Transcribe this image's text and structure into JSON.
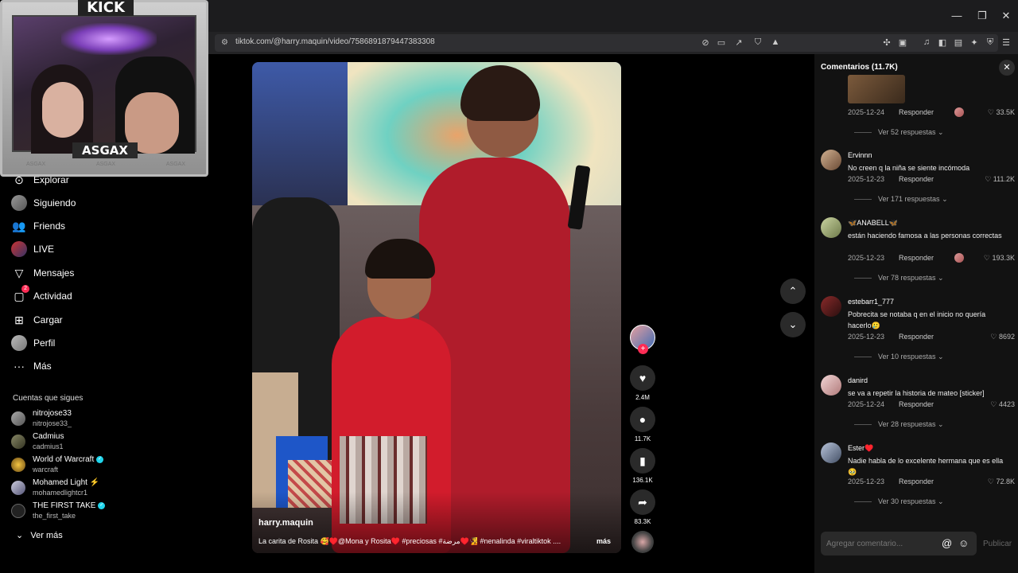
{
  "browser": {
    "url": "tiktok.com/@harry.maquin/video/7586891879447383308",
    "window_controls": [
      "—",
      "❐",
      "✕"
    ]
  },
  "webcam": {
    "brand": "KICK",
    "streamer": "ASGAX",
    "socials": [
      "ASGAX",
      "ASGAX",
      "ASGAX"
    ]
  },
  "sidebar": {
    "nav": [
      {
        "label": "Explorar",
        "icon": "explore-icon"
      },
      {
        "label": "Siguiendo",
        "icon": "following-icon"
      },
      {
        "label": "Friends",
        "icon": "friends-icon"
      },
      {
        "label": "LIVE",
        "icon": "live-icon"
      },
      {
        "label": "Mensajes",
        "icon": "messages-icon"
      },
      {
        "label": "Actividad",
        "icon": "activity-icon",
        "badge": "2"
      },
      {
        "label": "Cargar",
        "icon": "upload-icon"
      },
      {
        "label": "Perfil",
        "icon": "profile-icon"
      },
      {
        "label": "Más",
        "icon": "more-icon"
      }
    ],
    "following_title": "Cuentas que sigues",
    "following": [
      {
        "name": "nitrojose33",
        "user": "nitrojose33_",
        "verified": false
      },
      {
        "name": "Cadmius",
        "user": "cadmius1",
        "verified": false
      },
      {
        "name": "World of Warcraft",
        "user": "warcraft",
        "verified": true
      },
      {
        "name": "Mohamed Light ⚡",
        "user": "mohamedlightcr1",
        "verified": false
      },
      {
        "name": "THE FIRST TAKE",
        "user": "the_first_take",
        "verified": true
      }
    ],
    "see_more": "Ver más"
  },
  "video": {
    "author": "harry.maquin",
    "caption": "La carita de Rosita 🥰♥️@Mona y Rosita♥️ #preciosas #مرضة♥️🧏 #nenalinda #viraltiktok ....",
    "more": "más"
  },
  "actions": {
    "likes": "2.4M",
    "comments": "11.7K",
    "saves": "136.1K",
    "shares": "83.3K"
  },
  "comments_panel": {
    "title": "Comentarios (11.7K)",
    "reply_label": "Responder",
    "input_placeholder": "Agregar comentario...",
    "publish_label": "Publicar",
    "comments": [
      {
        "user": "",
        "text": "",
        "date": "2025-12-24",
        "likes": "33.5K",
        "creator_liked": true,
        "replies": "Ver 52 respuestas"
      },
      {
        "user": "Ervinnn",
        "text": "No creen q la niña se siente incómoda",
        "date": "2025-12-23",
        "likes": "111.2K",
        "creator_liked": false,
        "replies": "Ver 171 respuestas"
      },
      {
        "user": "🦋ANABELL🦋",
        "text": "están haciendo famosa a las personas correctas",
        "date": "2025-12-23",
        "likes": "193.3K",
        "creator_liked": true,
        "replies": "Ver 78 respuestas"
      },
      {
        "user": "estebarr1_777",
        "text": "Pobrecita se notaba q en el inicio no quería hacerlo🥲",
        "date": "2025-12-23",
        "likes": "8692",
        "creator_liked": false,
        "replies": "Ver 10 respuestas"
      },
      {
        "user": "danird",
        "text": "se va a repetir la historia de mateo [sticker]",
        "date": "2025-12-24",
        "likes": "4423",
        "creator_liked": false,
        "replies": "Ver 28 respuestas"
      },
      {
        "user": "Ester♥️",
        "text": "Nadie habla de lo excelente hermana que es ella 🥹",
        "date": "2025-12-23",
        "likes": "72.8K",
        "creator_liked": false,
        "replies": "Ver 30 respuestas"
      }
    ]
  },
  "colors": {
    "accent": "#fe2c55",
    "verified": "#20d5ec",
    "panel_bg": "#121212"
  }
}
